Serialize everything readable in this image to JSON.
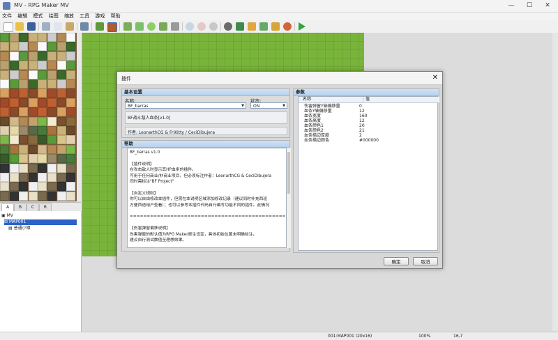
{
  "window": {
    "title": "MV - RPG Maker MV",
    "minimize": "—",
    "maximize": "☐",
    "close": "✕"
  },
  "menu": [
    "文件",
    "编辑",
    "模式",
    "绘图",
    "缩放",
    "工具",
    "游戏",
    "帮助"
  ],
  "palette_tabs": [
    "A",
    "B",
    "C",
    "R"
  ],
  "map_tree": {
    "project": "MV",
    "map": "MAP001",
    "child": "普通小镇"
  },
  "status": {
    "map_info": "001:MAP001 (20x16)",
    "zoom": "100%",
    "coords": "16,7"
  },
  "dialog": {
    "title": "插件",
    "basic": {
      "header": "基本设置",
      "name_label": "名称:",
      "name_value": "BF_barras",
      "status_label": "状态:",
      "status_value": "ON",
      "description": "BF战斗敌人血条[v1.0]",
      "author": "作者: LeonarthCG & FriKitty / CeciDibujera"
    },
    "help": {
      "header": "帮助",
      "text": "BF_barras v1.0\n\n【插件说明】\n在攻击敌人时显示其HP血条的插件。\n可用于任何商业/非商业项目，但必须标注作者：LeonarthCG & CeciDibujera\n同时需标注\"BF Project\"\n\n【自定义规则】\n你可以自由修改本插件，但需在本说明区域添加修改记录（建议同时补充西班\n方便西语用户查看）；也可以参考本插件代码自行编写功能不同的插件。此情况\n\n==================================================================\n\n【伤害弹窗偏移说明】\n伤害弹窗的默认值为RPG Maker原生设定，具体初始位置未明确标注，\n建议自行测试数值至理想效果。"
    },
    "params": {
      "header": "参数",
      "col_name": "名称",
      "col_value": "值",
      "rows": [
        {
          "name": "伤害弹窗Y轴偏移量",
          "value": "0"
        },
        {
          "name": "血条Y轴偏移量",
          "value": "12"
        },
        {
          "name": "血条宽度",
          "value": "160"
        },
        {
          "name": "血条高度",
          "value": "12"
        },
        {
          "name": "血条颜色1",
          "value": "20"
        },
        {
          "name": "血条颜色2",
          "value": "21"
        },
        {
          "name": "血条描边厚度",
          "value": "2"
        },
        {
          "name": "血条描边颜色",
          "value": "#000000"
        }
      ]
    },
    "ok_label": "确定",
    "cancel_label": "取消"
  }
}
